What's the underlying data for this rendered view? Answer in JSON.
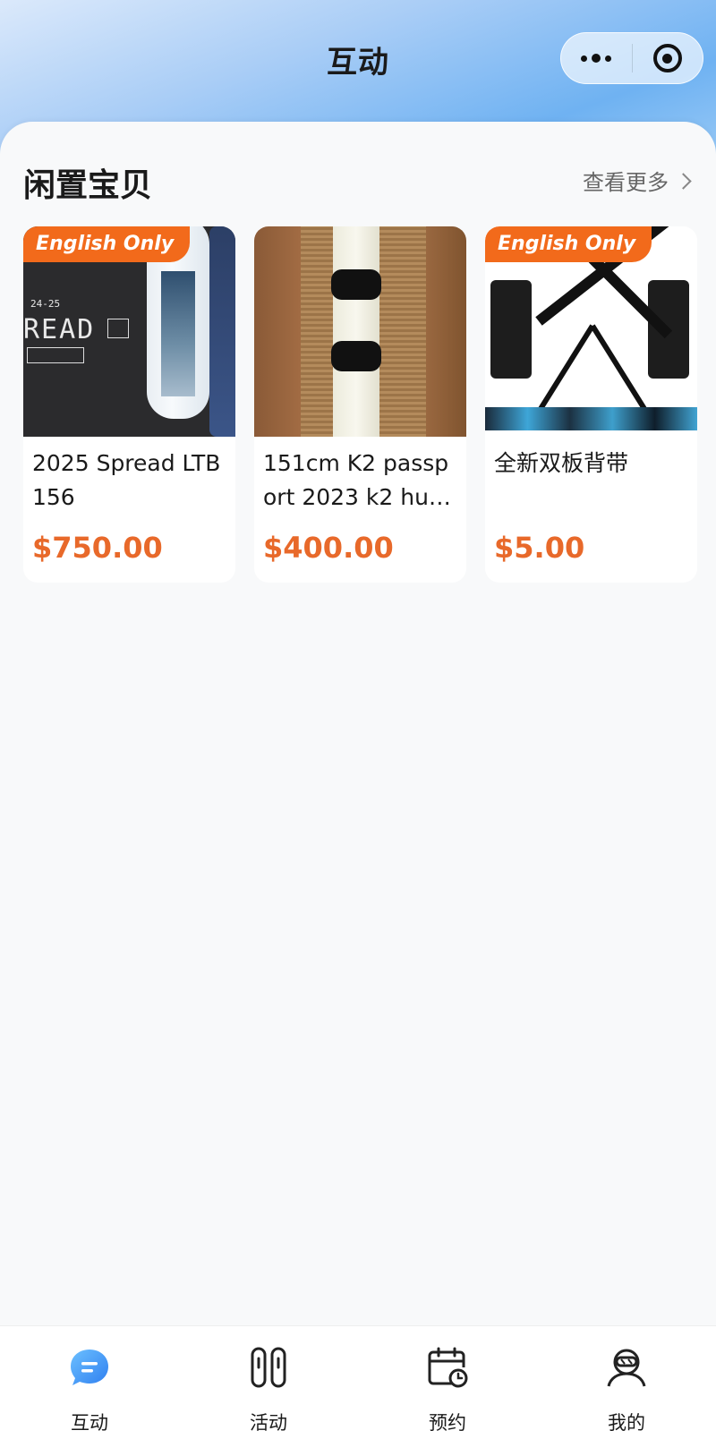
{
  "nav": {
    "title": "互动",
    "more_icon": "more-dots-icon",
    "close_icon": "target-icon"
  },
  "section": {
    "title": "闲置宝贝",
    "see_more": "查看更多"
  },
  "products": [
    {
      "badge": "English Only",
      "title": "2025 Spread LTB 156",
      "price": "$750.00",
      "image_text": [
        "24-25",
        "READ",
        "SPREAD"
      ]
    },
    {
      "badge": "",
      "title": "151cm K2 passport 2023 k2 hue ...",
      "price": "$400.00"
    },
    {
      "badge": "English Only",
      "title": "全新双板背带",
      "price": "$5.00"
    }
  ],
  "tabs": [
    {
      "label": "互动",
      "icon": "chat-bubble-icon",
      "active": true
    },
    {
      "label": "活动",
      "icon": "skis-icon",
      "active": false
    },
    {
      "label": "预约",
      "icon": "calendar-clock-icon",
      "active": false
    },
    {
      "label": "我的",
      "icon": "skier-avatar-icon",
      "active": false
    }
  ],
  "colors": {
    "accent": "#f26a1b",
    "price": "#e8692a",
    "tab_active": "#3d8ff0"
  }
}
